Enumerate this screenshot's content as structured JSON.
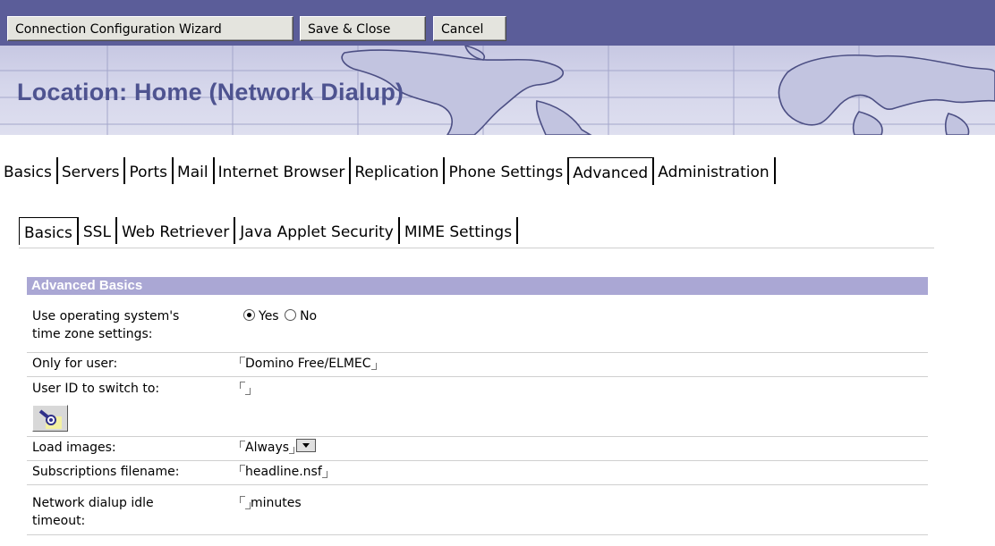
{
  "toolbar": {
    "wizard_label": "Connection Configuration Wizard",
    "save_close_label": "Save & Close",
    "cancel_label": "Cancel"
  },
  "banner": {
    "title": "Location: Home (Network Dialup)"
  },
  "main_tabs": [
    "Basics",
    "Servers",
    "Ports",
    "Mail",
    "Internet Browser",
    "Replication",
    "Phone Settings",
    "Advanced",
    "Administration"
  ],
  "main_tab_active": "Advanced",
  "sub_tabs": [
    "Basics",
    "SSL",
    "Web Retriever",
    "Java Applet Security",
    "MIME Settings"
  ],
  "sub_tab_active": "Basics",
  "section": {
    "title": "Advanced Basics",
    "timezone_label_line1": "Use operating system's",
    "timezone_label_line2": "time zone settings:",
    "timezone_yes": "Yes",
    "timezone_no": "No",
    "timezone_selected": "Yes",
    "only_for_user_label": "Only for user:",
    "only_for_user_value": "Domino Free/ELMEC",
    "user_id_label": "User ID to switch to:",
    "user_id_value": "",
    "load_images_label": "Load images:",
    "load_images_value": "Always",
    "subscriptions_label": "Subscriptions filename:",
    "subscriptions_value": "headline.nsf",
    "idle_label_line1": "Network dialup idle",
    "idle_label_line2": "timeout:",
    "idle_value": "",
    "idle_unit": "minutes"
  },
  "colors": {
    "toolbar_bg": "#5b5d99",
    "banner_title": "#4e5390",
    "section_header_bg": "#aaa7d4"
  },
  "icons": {
    "picker": "flashlight-icon"
  }
}
